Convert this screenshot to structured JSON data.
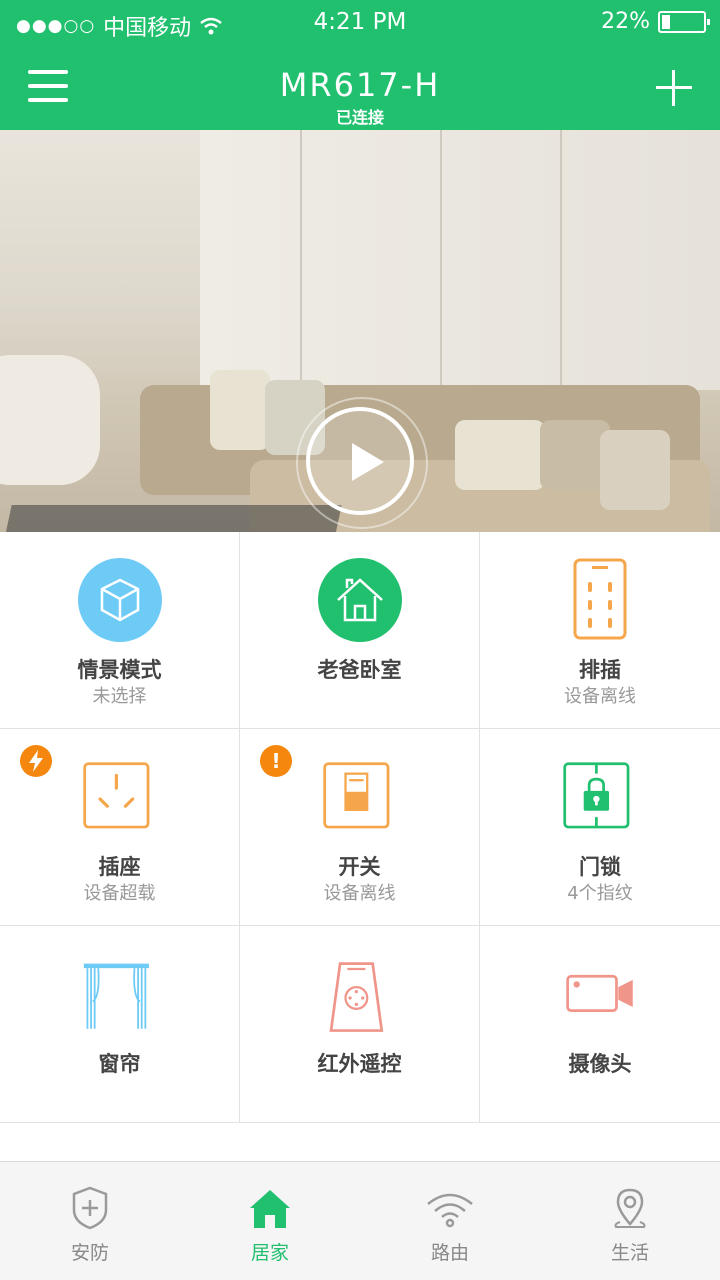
{
  "status_bar": {
    "signal": "●●●○○",
    "carrier": "中国移动",
    "time": "4:21 PM",
    "battery": "22%"
  },
  "header": {
    "title": "MR617-H",
    "subtitle": "已连接",
    "background": "#21c06f"
  },
  "banner": {
    "pages": 3,
    "active_page": 1
  },
  "devices": [
    {
      "label": "情景模式",
      "sub": "未选择",
      "icon": "cube-icon"
    },
    {
      "label": "老爸卧室",
      "sub": "",
      "icon": "home-icon"
    },
    {
      "label": "排插",
      "sub": "设备离线",
      "icon": "power-strip-icon"
    },
    {
      "label": "插座",
      "sub": "设备超载",
      "icon": "socket-icon",
      "badge": "lightning"
    },
    {
      "label": "开关",
      "sub": "设备离线",
      "icon": "switch-icon",
      "badge": "!"
    },
    {
      "label": "门锁",
      "sub": "4个指纹",
      "icon": "lock-icon"
    },
    {
      "label": "窗帘",
      "sub": "",
      "icon": "curtain-icon"
    },
    {
      "label": "红外遥控",
      "sub": "",
      "icon": "remote-icon"
    },
    {
      "label": "摄像头",
      "sub": "",
      "icon": "camera-icon"
    }
  ],
  "tabs": [
    {
      "label": "安防",
      "icon": "shield-icon"
    },
    {
      "label": "居家",
      "icon": "house-icon",
      "active": true
    },
    {
      "label": "路由",
      "icon": "wifi-icon"
    },
    {
      "label": "生活",
      "icon": "location-pin-icon"
    }
  ],
  "colors": {
    "accent": "#21c06f",
    "orange": "#f5a54a",
    "blue": "#6ecbf5",
    "salmon": "#f0958a",
    "badge": "#f5870f"
  }
}
